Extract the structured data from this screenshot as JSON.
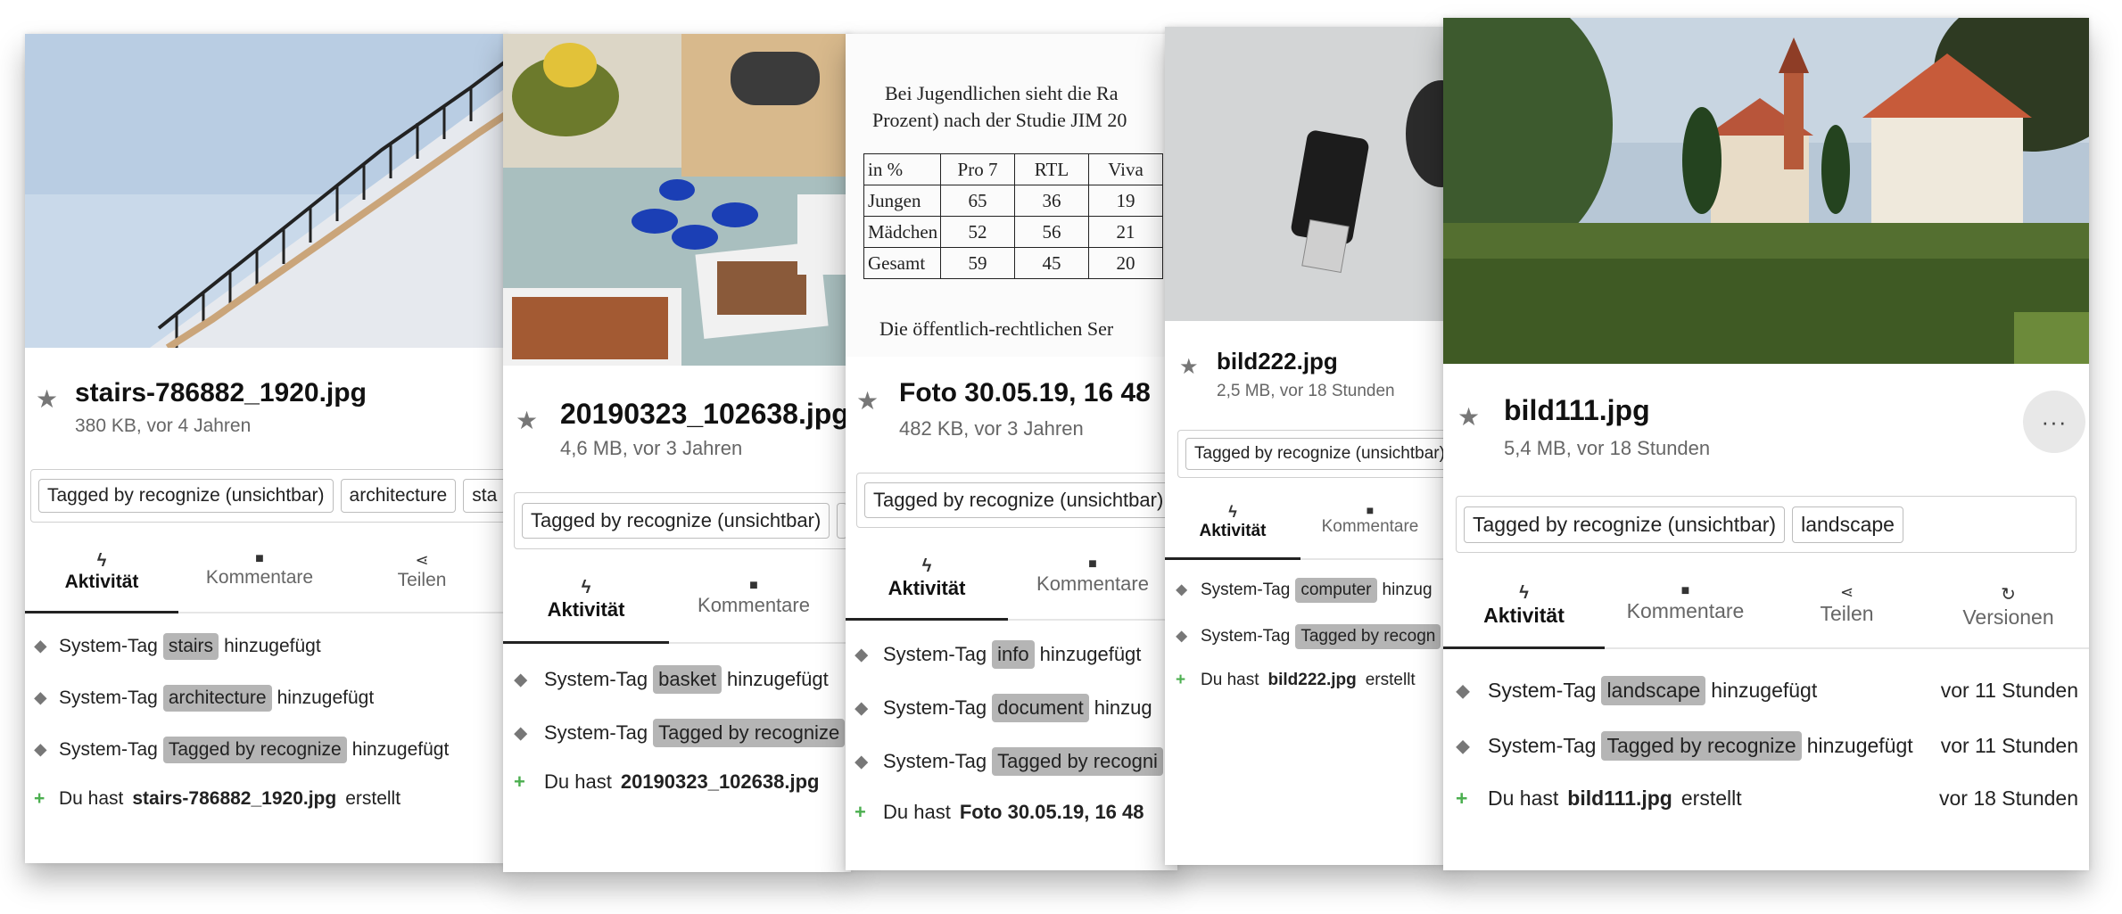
{
  "cards": [
    {
      "id": "c1",
      "file_name": "stairs-786882_1920.jpg",
      "meta": "380 KB, vor 4 Jahren",
      "tags": [
        "Tagged by recognize (unsichtbar)",
        "architecture",
        "sta"
      ],
      "tabs": [
        "Aktivität",
        "Kommentare",
        "Teilen"
      ],
      "activities": [
        {
          "prefix": "System-Tag",
          "tag": "stairs",
          "suffix": "hinzugefügt"
        },
        {
          "prefix": "System-Tag",
          "tag": "architecture",
          "suffix": "hinzugefügt"
        },
        {
          "prefix": "System-Tag",
          "tag": "Tagged by recognize",
          "suffix": "hinzugefügt"
        }
      ],
      "created": {
        "prefix": "Du hast",
        "file": "stairs-786882_1920.jpg",
        "suffix": "erstellt"
      }
    },
    {
      "id": "c2",
      "file_name": "20190323_102638.jpg",
      "meta": "4,6 MB, vor 3 Jahren",
      "tags": [
        "Tagged by recognize (unsichtbar)"
      ],
      "tabs": [
        "Aktivität",
        "Kommentare"
      ],
      "activities": [
        {
          "prefix": "System-Tag",
          "tag": "basket",
          "suffix": "hinzugefügt"
        },
        {
          "prefix": "System-Tag",
          "tag": "Tagged by recognize",
          "suffix": ""
        }
      ],
      "created": {
        "prefix": "Du hast",
        "file": "20190323_102638.jpg",
        "suffix": ""
      }
    },
    {
      "id": "c3",
      "file_name": "Foto 30.05.19, 16 48",
      "meta": "482 KB, vor 3 Jahren",
      "tags": [
        "Tagged by recognize (unsichtbar)"
      ],
      "tabs": [
        "Aktivität",
        "Kommentare"
      ],
      "activities": [
        {
          "prefix": "System-Tag",
          "tag": "info",
          "suffix": "hinzugefügt"
        },
        {
          "prefix": "System-Tag",
          "tag": "document",
          "suffix": "hinzug"
        },
        {
          "prefix": "System-Tag",
          "tag": "Tagged by recogni",
          "suffix": ""
        }
      ],
      "created": {
        "prefix": "Du hast",
        "file": "Foto 30.05.19, 16 48",
        "suffix": ""
      },
      "doc": {
        "heading1": "Bei Jugendlichen sieht die Ra",
        "heading2": "Prozent) nach der Studie JIM 20",
        "table_header": [
          "in %",
          "Pro 7",
          "RTL",
          "Viva"
        ],
        "table_rows": [
          [
            "Jungen",
            "65",
            "36",
            "19"
          ],
          [
            "Mädchen",
            "52",
            "56",
            "21"
          ],
          [
            "Gesamt",
            "59",
            "45",
            "20"
          ]
        ],
        "footer": "Die öffentlich-rechtlichen Ser"
      }
    },
    {
      "id": "c4",
      "file_name": "bild222.jpg",
      "meta": "2,5 MB, vor 18 Stunden",
      "tags": [
        "Tagged by recognize (unsichtbar)"
      ],
      "tabs": [
        "Aktivität",
        "Kommentare"
      ],
      "activities": [
        {
          "prefix": "System-Tag",
          "tag": "computer",
          "suffix": "hinzug"
        },
        {
          "prefix": "System-Tag",
          "tag": "Tagged by recogn",
          "suffix": ""
        }
      ],
      "created": {
        "prefix": "Du hast",
        "file": "bild222.jpg",
        "suffix": "erstellt"
      }
    },
    {
      "id": "c5",
      "file_name": "bild111.jpg",
      "meta": "5,4 MB, vor 18 Stunden",
      "more_label": "···",
      "tags": [
        "Tagged by recognize (unsichtbar)",
        "landscape"
      ],
      "tabs": [
        "Aktivität",
        "Kommentare",
        "Teilen",
        "Versionen"
      ],
      "activities": [
        {
          "prefix": "System-Tag",
          "tag": "landscape",
          "suffix": "hinzugefügt",
          "when": "vor 11 Stunden"
        },
        {
          "prefix": "System-Tag",
          "tag": "Tagged by recognize",
          "suffix": "hinzugefügt",
          "when": "vor 11 Stunden"
        }
      ],
      "created": {
        "prefix": "Du hast",
        "file": "bild111.jpg",
        "suffix": "erstellt",
        "when": "vor 18 Stunden"
      }
    }
  ],
  "icons": {
    "star": "star-icon",
    "tag": "tag-icon",
    "plus": "plus-icon",
    "activity": "lightning-icon",
    "comments": "comment-icon",
    "share": "share-icon",
    "versions": "history-icon",
    "more": "more-icon"
  },
  "colors": {
    "tag_highlight": "#b5b5b5",
    "plus_green": "#4caf50"
  }
}
